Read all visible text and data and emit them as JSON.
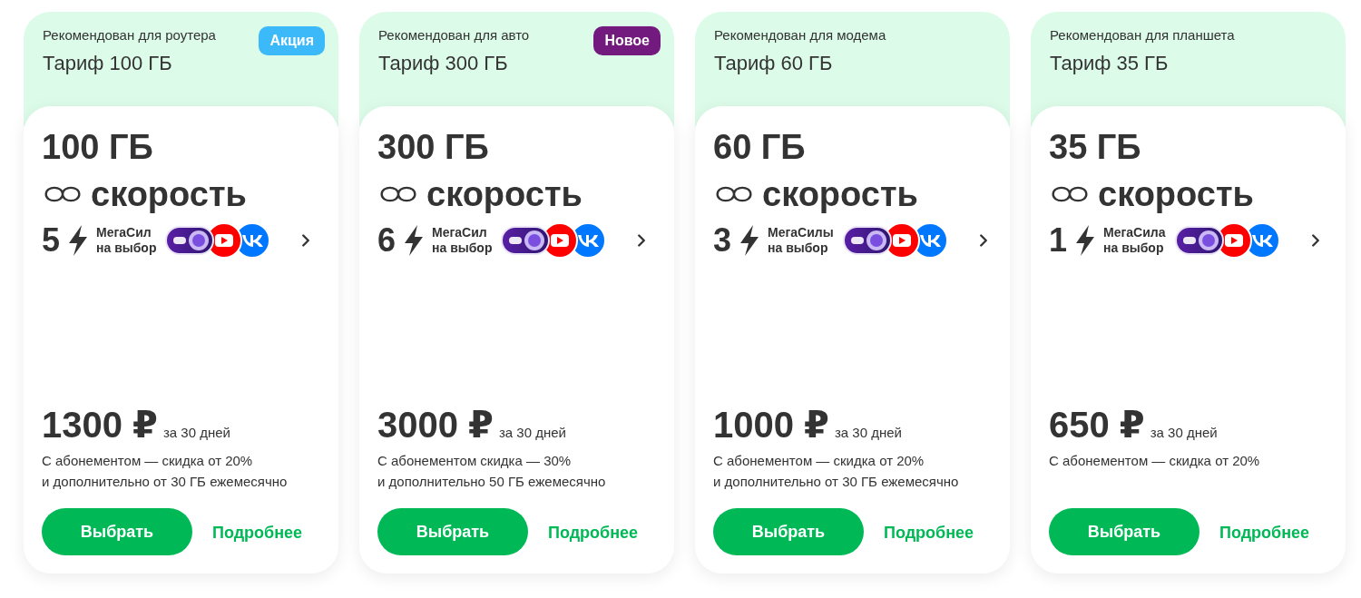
{
  "cards": [
    {
      "recommendation": "Рекомендован для роутера",
      "title": "Тариф 100 ГБ",
      "badge": {
        "text": "Акция",
        "color": "#3cb9f8"
      },
      "volume": "100 ГБ",
      "speed": "скорость",
      "powers": {
        "count": "5",
        "label": [
          "МегаСил",
          "на выбор"
        ]
      },
      "services": [
        {
          "kind": "pre5g"
        },
        {
          "kind": "youtube"
        },
        {
          "kind": "vk"
        }
      ],
      "price": "1300 ₽",
      "period": "за 30 дней",
      "conditions": [
        "С абонементом — скидка от 20%",
        "и дополнительно от 30 ГБ ежемесячно"
      ],
      "select_button": "Выбрать",
      "details_link": "Подробнее"
    },
    {
      "recommendation": "Рекомендован для авто",
      "title": "Тариф 300 ГБ",
      "badge": {
        "text": "Новое",
        "color": "#731a7e"
      },
      "volume": "300 ГБ",
      "speed": "скорость",
      "powers": {
        "count": "6",
        "label": [
          "МегаСил",
          "на выбор"
        ]
      },
      "services": [
        {
          "kind": "pre5g"
        },
        {
          "kind": "youtube"
        },
        {
          "kind": "vk"
        }
      ],
      "price": "3000 ₽",
      "period": "за 30 дней",
      "conditions": [
        "С абонементом скидка — 30%",
        "и дополнительно 50 ГБ ежемесячно"
      ],
      "select_button": "Выбрать",
      "details_link": "Подробнее"
    },
    {
      "recommendation": "Рекомендован для модема",
      "title": "Тариф 60 ГБ",
      "volume": "60 ГБ",
      "speed": "скорость",
      "powers": {
        "count": "3",
        "label": [
          "МегаСилы",
          "на выбор"
        ]
      },
      "services": [
        {
          "kind": "pre5g"
        },
        {
          "kind": "youtube"
        },
        {
          "kind": "vk"
        }
      ],
      "price": "1000 ₽",
      "period": "за 30 дней",
      "conditions": [
        "С абонементом — скидка от 20%",
        "и дополнительно от 30 ГБ ежемесячно"
      ],
      "select_button": "Выбрать",
      "details_link": "Подробнее"
    },
    {
      "recommendation": "Рекомендован для планшета",
      "title": "Тариф 35 ГБ",
      "volume": "35 ГБ",
      "speed": "скорость",
      "powers": {
        "count": "1",
        "label": [
          "МегаСила",
          "на выбор"
        ]
      },
      "services": [
        {
          "kind": "pre5g"
        },
        {
          "kind": "youtube"
        },
        {
          "kind": "vk"
        }
      ],
      "price": "650 ₽",
      "period": "за 30 дней",
      "conditions": [
        "С абонементом — скидка от 20%"
      ],
      "select_button": "Выбрать",
      "details_link": "Подробнее"
    }
  ]
}
